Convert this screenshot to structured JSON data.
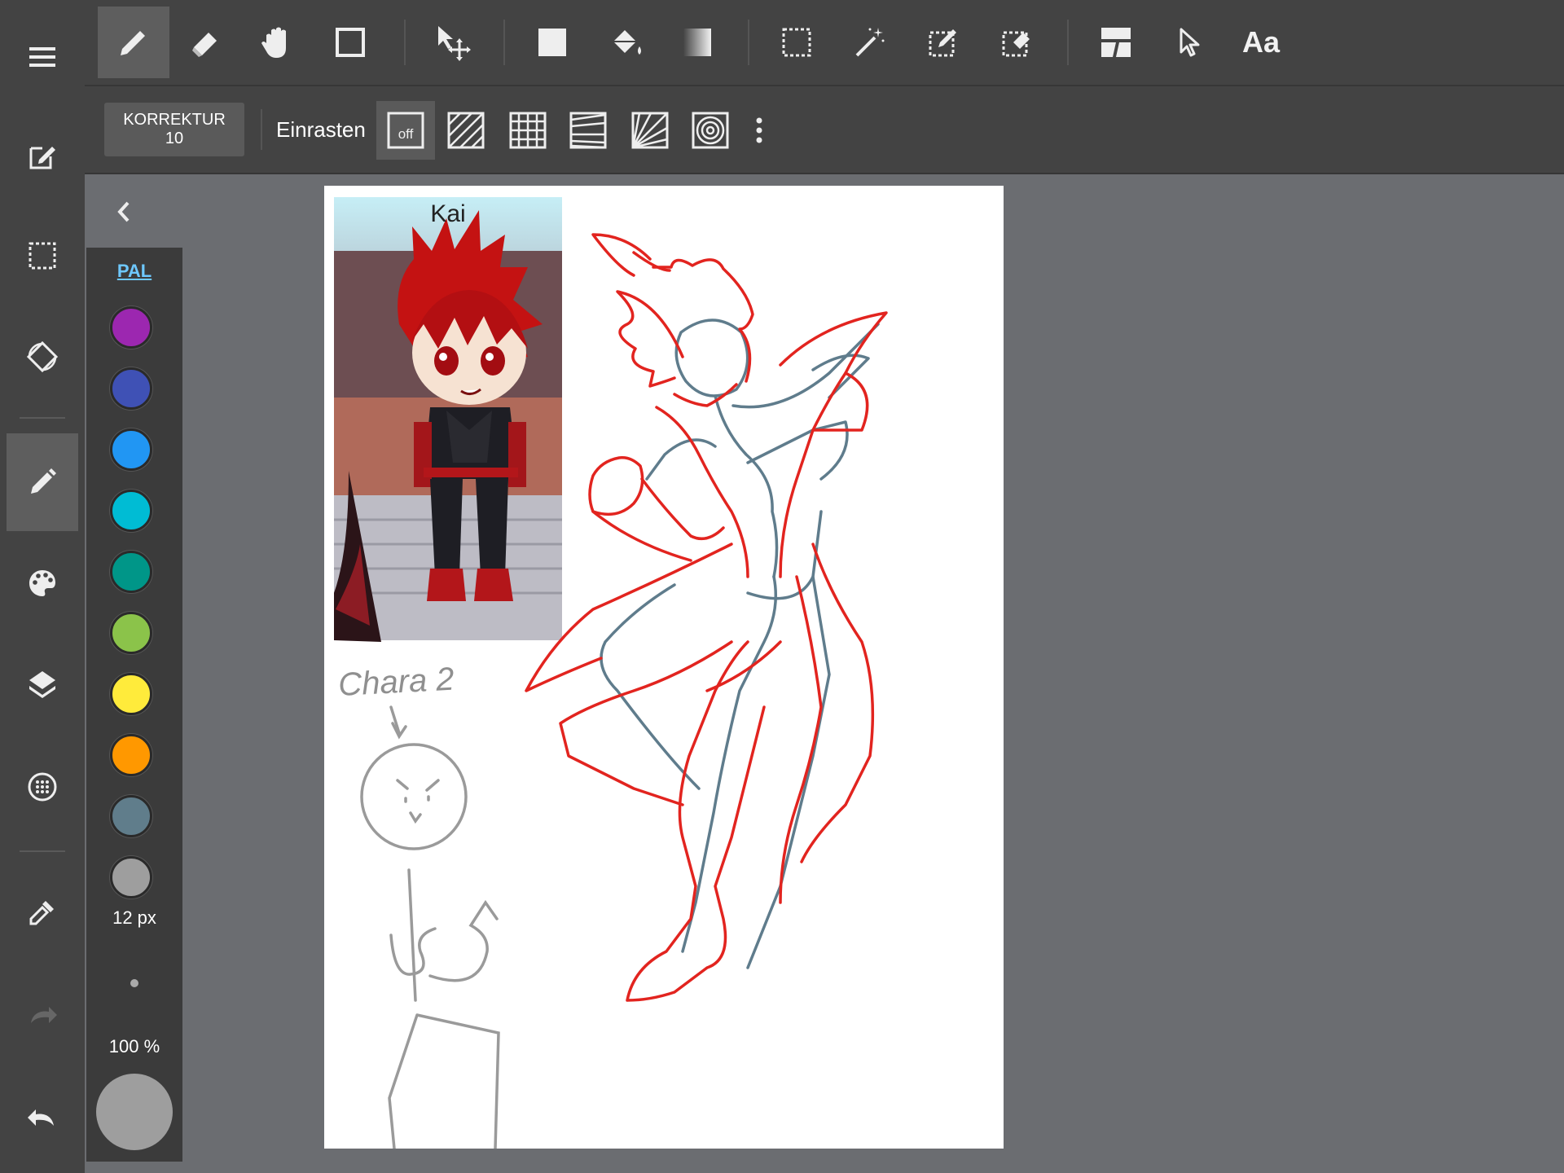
{
  "toolbar": {
    "tools": [
      {
        "icon": "pencil-icon",
        "active": true
      },
      {
        "icon": "eraser-icon"
      },
      {
        "icon": "hand-icon"
      },
      {
        "icon": "rectangle-shape-icon"
      },
      {
        "icon": "move-transform-icon"
      },
      {
        "icon": "fill-rectangle-icon"
      },
      {
        "icon": "paint-bucket-icon"
      },
      {
        "icon": "gradient-icon"
      },
      {
        "icon": "select-rectangle-icon"
      },
      {
        "icon": "magic-wand-icon"
      },
      {
        "icon": "select-pen-icon"
      },
      {
        "icon": "select-eraser-icon"
      },
      {
        "icon": "frame-divider-icon"
      },
      {
        "icon": "pointer-icon"
      }
    ],
    "text_tool_label": "Aa"
  },
  "subbar": {
    "correction_label": "KORREKTUR",
    "correction_value": "10",
    "snap_label": "Einrasten",
    "snap_off_label": "off",
    "snap_modes": [
      "snap-off-icon",
      "snap-parallel-icon",
      "snap-grid-icon",
      "snap-perspective-icon",
      "snap-radial-icon",
      "snap-circle-icon",
      "more-vert-icon"
    ]
  },
  "sidebar": {
    "items": [
      "menu-icon",
      "edit-canvas-icon",
      "selection-icon",
      "rotate-icon",
      "brush-icon",
      "palette-icon",
      "layers-icon",
      "material-icon",
      "eyedropper-icon",
      "redo-icon",
      "undo-icon"
    ]
  },
  "palette": {
    "label": "PAL",
    "colors": [
      "#9c27b0",
      "#3f51b5",
      "#2196f3",
      "#00bcd4",
      "#009688",
      "#8bc34a",
      "#ffeb3b",
      "#ff9800",
      "#607d8b",
      "#9e9e9e"
    ],
    "brush_size": "12 px",
    "opacity": "100 %",
    "current_color": "#9e9e9e"
  },
  "canvas": {
    "reference_name": "Kai",
    "note_text": "Chara 2"
  }
}
